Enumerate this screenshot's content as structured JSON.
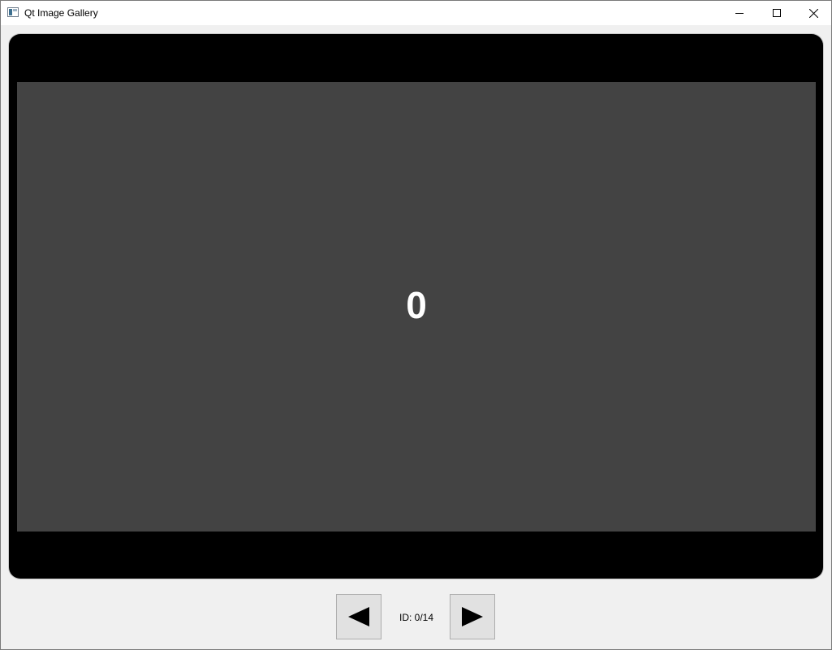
{
  "window": {
    "title": "Qt Image Gallery",
    "icon": "app-window-icon",
    "controls": [
      "minimize-icon",
      "maximize-icon",
      "close-icon"
    ]
  },
  "viewer": {
    "current_image_label": "0",
    "background_color": "#000000",
    "image_color": "#434343"
  },
  "navigation": {
    "prev_icon": "triangle-left-icon",
    "next_icon": "triangle-right-icon",
    "id_label": "ID: 0/14"
  }
}
